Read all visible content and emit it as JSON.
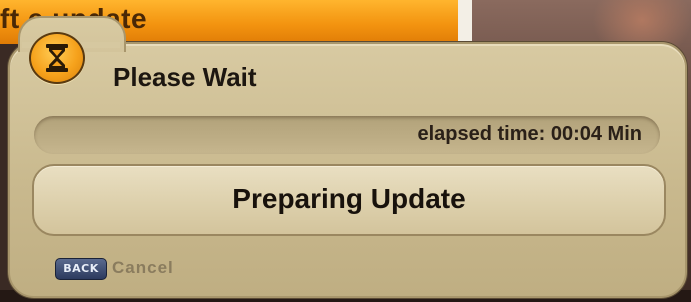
{
  "background": {
    "banner_text": "ft    e update"
  },
  "dialog": {
    "icon": "hourglass-icon",
    "title": "Please Wait",
    "elapsed_label": "elapsed time: ",
    "elapsed_value": "00:04 Min",
    "status": "Preparing Update",
    "footer": {
      "key_label": "BACK",
      "action_label": "Cancel"
    }
  },
  "colors": {
    "accent_orange": "#f39410",
    "dialog_beige": "#c9b98e",
    "back_key_blue": "#2c3a5e"
  }
}
